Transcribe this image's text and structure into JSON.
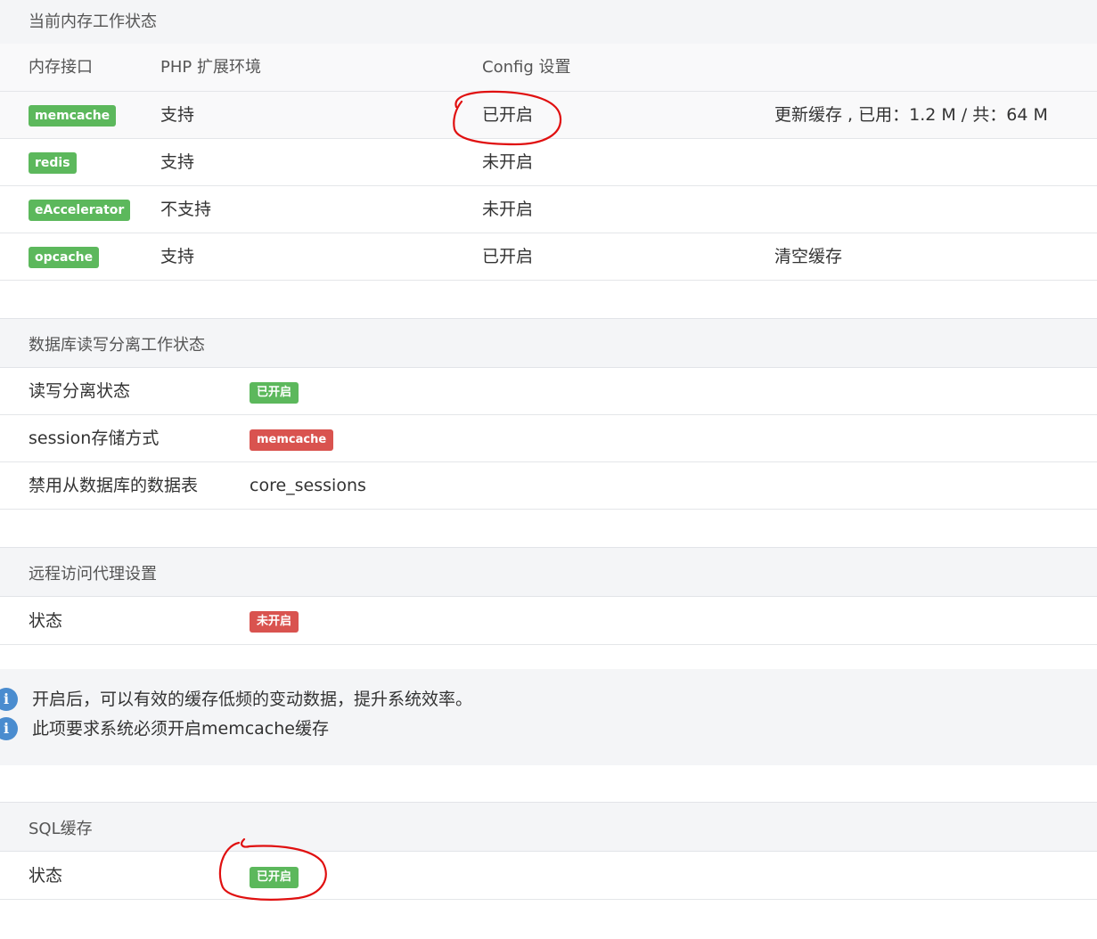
{
  "memory": {
    "title": "当前内存工作状态",
    "columns": [
      "内存接口",
      "PHP 扩展环境",
      "Config 设置"
    ],
    "rows": [
      {
        "name": "memcache",
        "php": "支持",
        "config": "已开启",
        "extra": "更新缓存 , 已用：1.2 M / 共：64 M"
      },
      {
        "name": "redis",
        "php": "支持",
        "config": "未开启",
        "extra": ""
      },
      {
        "name": "eAccelerator",
        "php": "不支持",
        "config": "未开启",
        "extra": ""
      },
      {
        "name": "opcache",
        "php": "支持",
        "config": "已开启",
        "extra": "清空缓存"
      }
    ]
  },
  "db": {
    "title": "数据库读写分离工作状态",
    "rows": [
      {
        "label": "读写分离状态",
        "badge": "已开启",
        "badge_color": "#5cb85c"
      },
      {
        "label": "session存储方式",
        "badge": "memcache",
        "badge_color": "#d9534f"
      },
      {
        "label": "禁用从数据库的数据表",
        "value": "core_sessions"
      }
    ]
  },
  "proxy": {
    "title": "远程访问代理设置",
    "status_label": "状态",
    "status_badge": "未开启",
    "badge_color": "#d9534f"
  },
  "notice": {
    "lines": [
      "开启后，可以有效的缓存低频的变动数据，提升系统效率。",
      "此项要求系统必须开启memcache缓存"
    ],
    "icon": "info-icon"
  },
  "sql": {
    "title": "SQL缓存",
    "status_label": "状态",
    "status_badge": "已开启",
    "badge_color": "#5cb85c"
  },
  "colors": {
    "green": "#5cb85c",
    "red": "#d9534f",
    "info_blue": "#4a8ccf",
    "annotation_red": "#e01010"
  }
}
